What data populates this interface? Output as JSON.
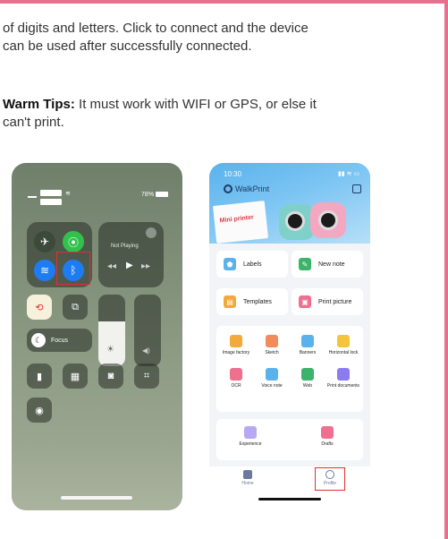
{
  "instructions": {
    "line1": "of digits and letters. Click to connect and the device",
    "line2": "can be used after successfully connected.",
    "warm_label": "Warm Tips:",
    "warm_text": " It must work with WIFI or GPS, or else it",
    "warm_text2": "can't print."
  },
  "control_center": {
    "battery": "78%",
    "now_playing": "Not Playing",
    "focus_label": "Focus"
  },
  "app": {
    "time": "10:30",
    "brand": "WalkPrint",
    "paper_label": "Mini printer",
    "main_cards": [
      {
        "label": "Labels"
      },
      {
        "label": "New note"
      },
      {
        "label": "Templates"
      },
      {
        "label": "Print picture"
      }
    ],
    "grid_items": [
      {
        "label": "Image factory"
      },
      {
        "label": "Sketch"
      },
      {
        "label": "Banners"
      },
      {
        "label": "Horizontal lock"
      },
      {
        "label": "OCR"
      },
      {
        "label": "Voice note"
      },
      {
        "label": "Web"
      },
      {
        "label": "Print documents"
      }
    ],
    "bottom_cards": [
      {
        "label": "Experience"
      },
      {
        "label": "Drafts"
      }
    ],
    "tabs": [
      {
        "label": "Home"
      },
      {
        "label": "Profile"
      }
    ]
  },
  "colors": {
    "frame": "#e8708f",
    "highlight": "#e0302f",
    "app_accent": "#5ab2ec"
  }
}
